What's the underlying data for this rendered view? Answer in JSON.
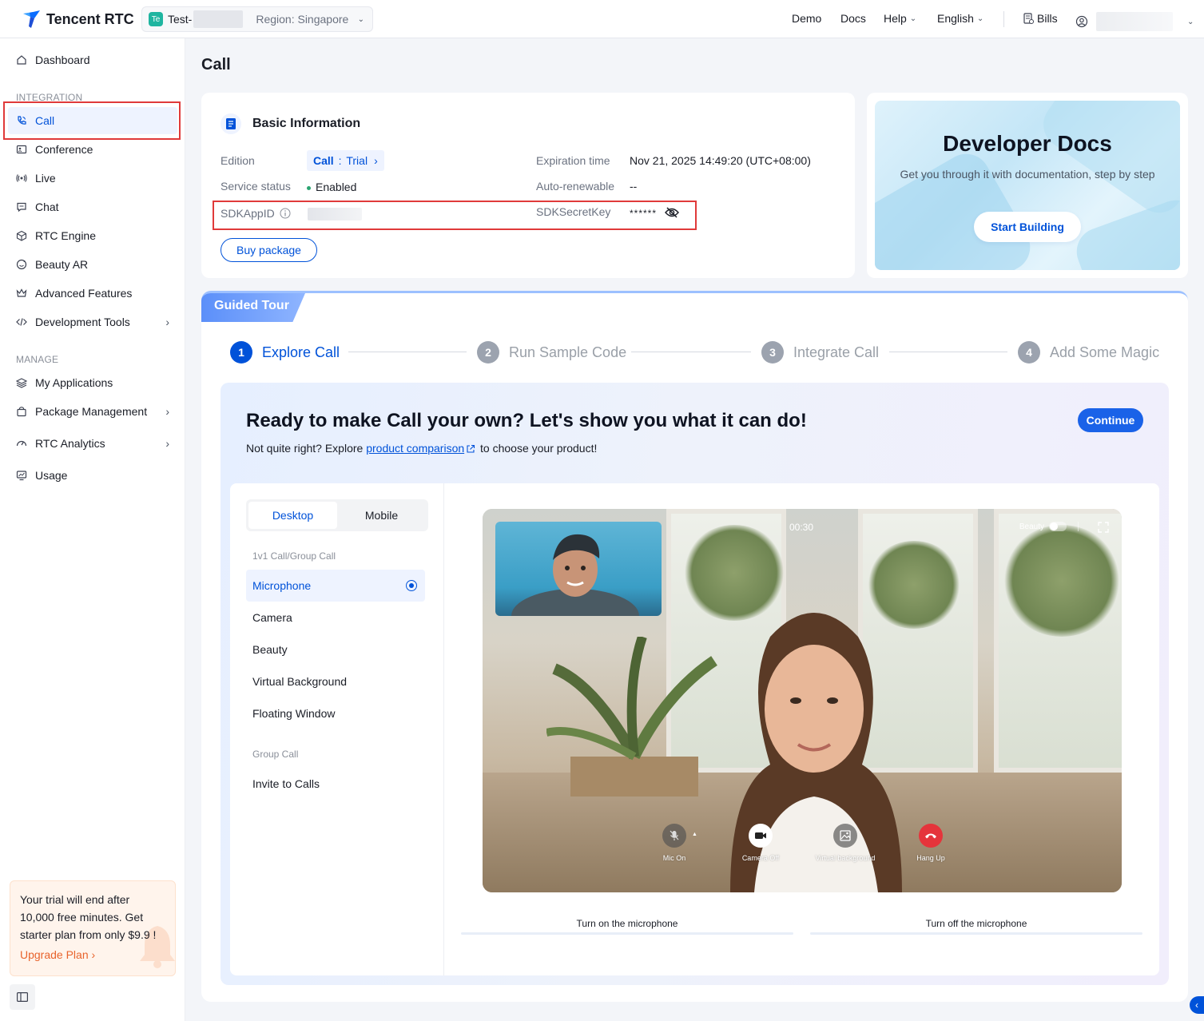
{
  "header": {
    "brand": "Tencent RTC",
    "app": {
      "badge": "Te",
      "name": "Test-",
      "region": "Region: Singapore"
    },
    "nav": {
      "demo": "Demo",
      "docs": "Docs",
      "help": "Help",
      "language": "English",
      "bills": "Bills"
    }
  },
  "sidebar": {
    "dashboard": "Dashboard",
    "integration_label": "INTEGRATION",
    "integration": [
      "Call",
      "Conference",
      "Live",
      "Chat",
      "RTC Engine",
      "Beauty AR",
      "Advanced Features",
      "Development Tools"
    ],
    "manage_label": "MANAGE",
    "manage": [
      "My Applications",
      "Package Management",
      "RTC Analytics",
      "Usage"
    ],
    "trial": {
      "text": "Your trial will end after 10,000 free minutes. Get starter plan from only $9.9 !",
      "link": "Upgrade Plan"
    }
  },
  "page": {
    "title": "Call"
  },
  "basic_info": {
    "title": "Basic Information",
    "edition_label": "Edition",
    "edition_product": "Call",
    "edition_sep": " : ",
    "edition_plan": "Trial",
    "status_label": "Service status",
    "status_value": "Enabled",
    "sdkappid_label": "SDKAppID",
    "expiration_label": "Expiration time",
    "expiration_value": "Nov 21, 2025 14:49:20 (UTC+08:00)",
    "autorenew_label": "Auto-renewable",
    "autorenew_value": "--",
    "secretkey_label": "SDKSecretKey",
    "secretkey_value": "******",
    "buy_button": "Buy package"
  },
  "dev_docs": {
    "title": "Developer Docs",
    "subtitle": "Get you through it with documentation, step by step",
    "button": "Start Building"
  },
  "guided_tour": {
    "tab": "Guided Tour",
    "steps": [
      {
        "num": "1",
        "label": "Explore Call"
      },
      {
        "num": "2",
        "label": "Run Sample Code"
      },
      {
        "num": "3",
        "label": "Integrate Call"
      },
      {
        "num": "4",
        "label": "Add Some Magic"
      }
    ],
    "heading": "Ready to make Call your own? Let's show you what it can do!",
    "sub_prefix": "Not quite right? Explore ",
    "sub_link": "product comparison",
    "sub_suffix": " to choose your product!",
    "continue": "Continue"
  },
  "demo": {
    "tabs": [
      "Desktop",
      "Mobile"
    ],
    "group1": "1v1 Call/Group Call",
    "features": [
      "Microphone",
      "Camera",
      "Beauty",
      "Virtual Background",
      "Floating Window"
    ],
    "group2": "Group Call",
    "group_features": [
      "Invite to Calls"
    ],
    "video": {
      "timer": "00:30",
      "beauty": "Beauty",
      "controls": [
        "Mic On",
        "Camera Off",
        "Virtual background",
        "Hang Up"
      ]
    },
    "captions": [
      "Turn on the microphone",
      "Turn off the microphone"
    ]
  },
  "colors": {
    "primary": "#0052d9",
    "accent_orange": "#e8632c",
    "highlight": "#e03a3a",
    "hangup": "#e5343b"
  }
}
